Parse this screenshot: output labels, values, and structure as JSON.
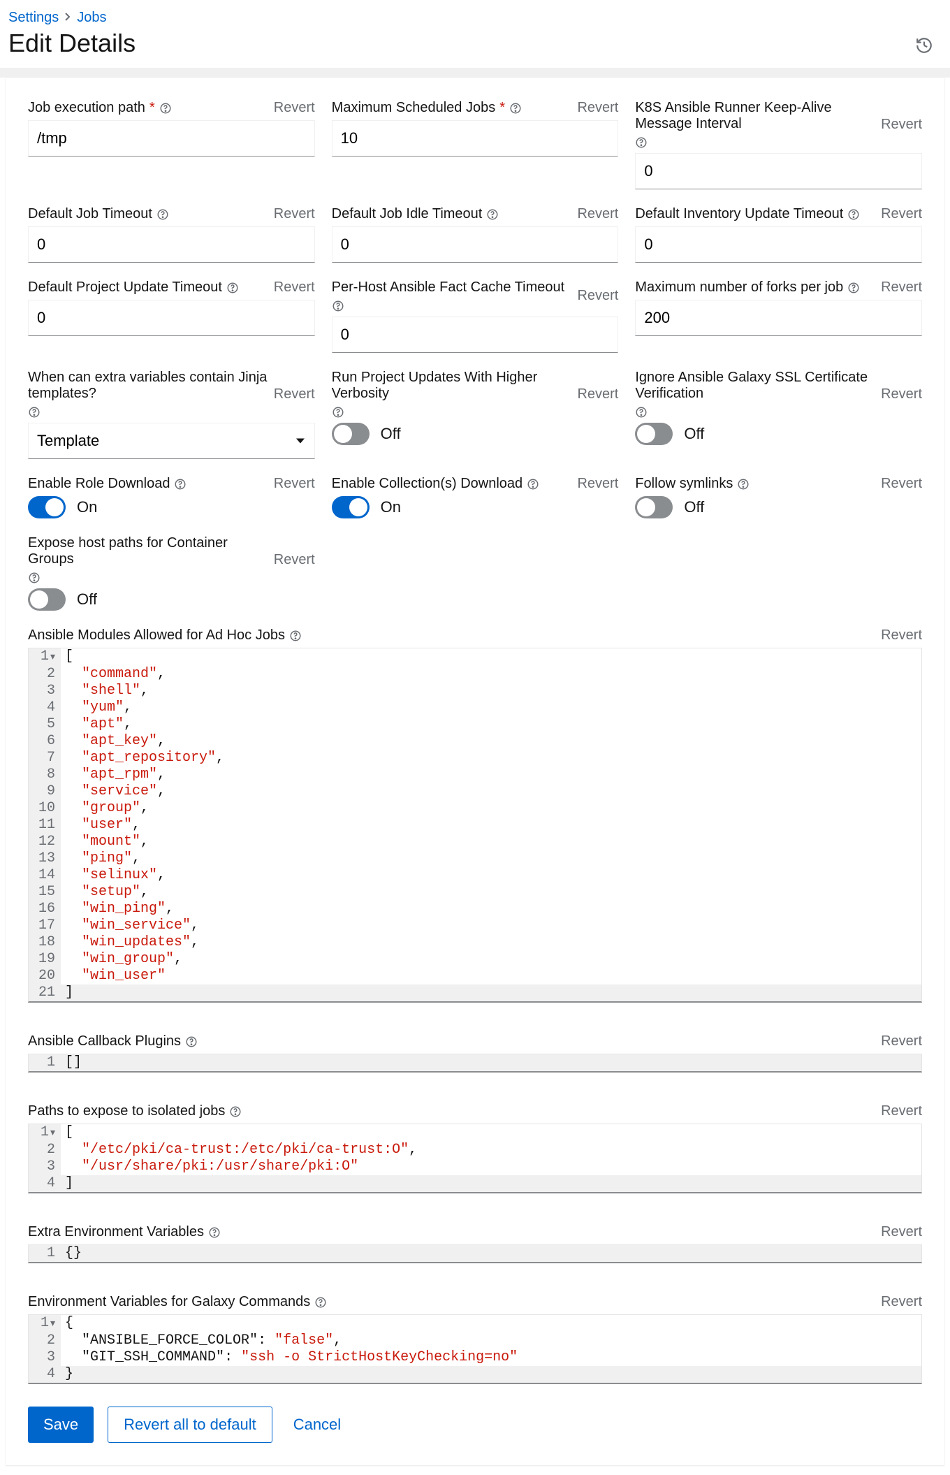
{
  "breadcrumb": {
    "settings": "Settings",
    "jobs": "Jobs"
  },
  "page_title": "Edit Details",
  "revert_label": "Revert",
  "fields": {
    "job_exec_path": {
      "label": "Job execution path",
      "required": true,
      "value": "/tmp"
    },
    "max_scheduled": {
      "label": "Maximum Scheduled Jobs",
      "required": true,
      "value": "10"
    },
    "k8s_keepalive": {
      "label": "K8S Ansible Runner Keep-Alive Message Interval",
      "required": false,
      "value": "0"
    },
    "default_job_timeout": {
      "label": "Default Job Timeout",
      "value": "0"
    },
    "default_job_idle": {
      "label": "Default Job Idle Timeout",
      "value": "0"
    },
    "default_inv_update": {
      "label": "Default Inventory Update Timeout",
      "value": "0"
    },
    "default_proj_update": {
      "label": "Default Project Update Timeout",
      "value": "0"
    },
    "per_host_fact_cache": {
      "label": "Per-Host Ansible Fact Cache Timeout",
      "value": "0"
    },
    "max_forks": {
      "label": "Maximum number of forks per job",
      "value": "200"
    },
    "jinja": {
      "label": "When can extra variables contain Jinja templates?",
      "value": "Template"
    },
    "higher_verbosity": {
      "label": "Run Project Updates With Higher Verbosity",
      "on": false,
      "text_off": "Off"
    },
    "ignore_ssl": {
      "label": "Ignore Ansible Galaxy SSL Certificate Verification",
      "on": false,
      "text_off": "Off"
    },
    "enable_role_dl": {
      "label": "Enable Role Download",
      "on": true,
      "text_on": "On"
    },
    "enable_coll_dl": {
      "label": "Enable Collection(s) Download",
      "on": true,
      "text_on": "On"
    },
    "follow_symlinks": {
      "label": "Follow symlinks",
      "on": false,
      "text_off": "Off"
    },
    "expose_host_paths": {
      "label": "Expose host paths for Container Groups",
      "on": false,
      "text_off": "Off"
    }
  },
  "adhoc_modules": {
    "label": "Ansible Modules Allowed for Ad Hoc Jobs",
    "items": [
      "command",
      "shell",
      "yum",
      "apt",
      "apt_key",
      "apt_repository",
      "apt_rpm",
      "service",
      "group",
      "user",
      "mount",
      "ping",
      "selinux",
      "setup",
      "win_ping",
      "win_service",
      "win_updates",
      "win_group",
      "win_user"
    ]
  },
  "callback_plugins": {
    "label": "Ansible Callback Plugins",
    "value": "[]"
  },
  "isolated_paths": {
    "label": "Paths to expose to isolated jobs",
    "items": [
      "/etc/pki/ca-trust:/etc/pki/ca-trust:O",
      "/usr/share/pki:/usr/share/pki:O"
    ]
  },
  "extra_env": {
    "label": "Extra Environment Variables",
    "value": "{}"
  },
  "galaxy_env": {
    "label": "Environment Variables for Galaxy Commands",
    "entries": [
      {
        "k": "ANSIBLE_FORCE_COLOR",
        "v": "false"
      },
      {
        "k": "GIT_SSH_COMMAND",
        "v": "ssh -o StrictHostKeyChecking=no"
      }
    ]
  },
  "actions": {
    "save": "Save",
    "revert_all": "Revert all to default",
    "cancel": "Cancel"
  }
}
